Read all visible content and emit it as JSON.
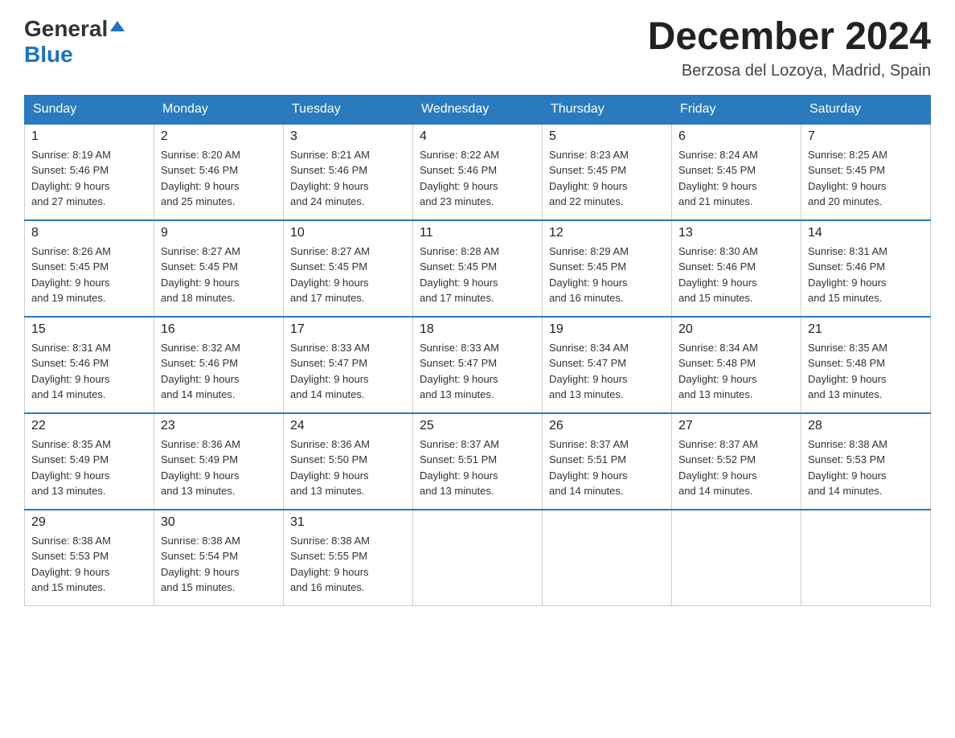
{
  "header": {
    "logo": {
      "general": "General",
      "blue": "Blue",
      "tagline": ""
    },
    "title": "December 2024",
    "subtitle": "Berzosa del Lozoya, Madrid, Spain"
  },
  "days_of_week": [
    "Sunday",
    "Monday",
    "Tuesday",
    "Wednesday",
    "Thursday",
    "Friday",
    "Saturday"
  ],
  "weeks": [
    [
      {
        "day": "1",
        "sunrise": "Sunrise: 8:19 AM",
        "sunset": "Sunset: 5:46 PM",
        "daylight": "Daylight: 9 hours and 27 minutes."
      },
      {
        "day": "2",
        "sunrise": "Sunrise: 8:20 AM",
        "sunset": "Sunset: 5:46 PM",
        "daylight": "Daylight: 9 hours and 25 minutes."
      },
      {
        "day": "3",
        "sunrise": "Sunrise: 8:21 AM",
        "sunset": "Sunset: 5:46 PM",
        "daylight": "Daylight: 9 hours and 24 minutes."
      },
      {
        "day": "4",
        "sunrise": "Sunrise: 8:22 AM",
        "sunset": "Sunset: 5:46 PM",
        "daylight": "Daylight: 9 hours and 23 minutes."
      },
      {
        "day": "5",
        "sunrise": "Sunrise: 8:23 AM",
        "sunset": "Sunset: 5:45 PM",
        "daylight": "Daylight: 9 hours and 22 minutes."
      },
      {
        "day": "6",
        "sunrise": "Sunrise: 8:24 AM",
        "sunset": "Sunset: 5:45 PM",
        "daylight": "Daylight: 9 hours and 21 minutes."
      },
      {
        "day": "7",
        "sunrise": "Sunrise: 8:25 AM",
        "sunset": "Sunset: 5:45 PM",
        "daylight": "Daylight: 9 hours and 20 minutes."
      }
    ],
    [
      {
        "day": "8",
        "sunrise": "Sunrise: 8:26 AM",
        "sunset": "Sunset: 5:45 PM",
        "daylight": "Daylight: 9 hours and 19 minutes."
      },
      {
        "day": "9",
        "sunrise": "Sunrise: 8:27 AM",
        "sunset": "Sunset: 5:45 PM",
        "daylight": "Daylight: 9 hours and 18 minutes."
      },
      {
        "day": "10",
        "sunrise": "Sunrise: 8:27 AM",
        "sunset": "Sunset: 5:45 PM",
        "daylight": "Daylight: 9 hours and 17 minutes."
      },
      {
        "day": "11",
        "sunrise": "Sunrise: 8:28 AM",
        "sunset": "Sunset: 5:45 PM",
        "daylight": "Daylight: 9 hours and 17 minutes."
      },
      {
        "day": "12",
        "sunrise": "Sunrise: 8:29 AM",
        "sunset": "Sunset: 5:45 PM",
        "daylight": "Daylight: 9 hours and 16 minutes."
      },
      {
        "day": "13",
        "sunrise": "Sunrise: 8:30 AM",
        "sunset": "Sunset: 5:46 PM",
        "daylight": "Daylight: 9 hours and 15 minutes."
      },
      {
        "day": "14",
        "sunrise": "Sunrise: 8:31 AM",
        "sunset": "Sunset: 5:46 PM",
        "daylight": "Daylight: 9 hours and 15 minutes."
      }
    ],
    [
      {
        "day": "15",
        "sunrise": "Sunrise: 8:31 AM",
        "sunset": "Sunset: 5:46 PM",
        "daylight": "Daylight: 9 hours and 14 minutes."
      },
      {
        "day": "16",
        "sunrise": "Sunrise: 8:32 AM",
        "sunset": "Sunset: 5:46 PM",
        "daylight": "Daylight: 9 hours and 14 minutes."
      },
      {
        "day": "17",
        "sunrise": "Sunrise: 8:33 AM",
        "sunset": "Sunset: 5:47 PM",
        "daylight": "Daylight: 9 hours and 14 minutes."
      },
      {
        "day": "18",
        "sunrise": "Sunrise: 8:33 AM",
        "sunset": "Sunset: 5:47 PM",
        "daylight": "Daylight: 9 hours and 13 minutes."
      },
      {
        "day": "19",
        "sunrise": "Sunrise: 8:34 AM",
        "sunset": "Sunset: 5:47 PM",
        "daylight": "Daylight: 9 hours and 13 minutes."
      },
      {
        "day": "20",
        "sunrise": "Sunrise: 8:34 AM",
        "sunset": "Sunset: 5:48 PM",
        "daylight": "Daylight: 9 hours and 13 minutes."
      },
      {
        "day": "21",
        "sunrise": "Sunrise: 8:35 AM",
        "sunset": "Sunset: 5:48 PM",
        "daylight": "Daylight: 9 hours and 13 minutes."
      }
    ],
    [
      {
        "day": "22",
        "sunrise": "Sunrise: 8:35 AM",
        "sunset": "Sunset: 5:49 PM",
        "daylight": "Daylight: 9 hours and 13 minutes."
      },
      {
        "day": "23",
        "sunrise": "Sunrise: 8:36 AM",
        "sunset": "Sunset: 5:49 PM",
        "daylight": "Daylight: 9 hours and 13 minutes."
      },
      {
        "day": "24",
        "sunrise": "Sunrise: 8:36 AM",
        "sunset": "Sunset: 5:50 PM",
        "daylight": "Daylight: 9 hours and 13 minutes."
      },
      {
        "day": "25",
        "sunrise": "Sunrise: 8:37 AM",
        "sunset": "Sunset: 5:51 PM",
        "daylight": "Daylight: 9 hours and 13 minutes."
      },
      {
        "day": "26",
        "sunrise": "Sunrise: 8:37 AM",
        "sunset": "Sunset: 5:51 PM",
        "daylight": "Daylight: 9 hours and 14 minutes."
      },
      {
        "day": "27",
        "sunrise": "Sunrise: 8:37 AM",
        "sunset": "Sunset: 5:52 PM",
        "daylight": "Daylight: 9 hours and 14 minutes."
      },
      {
        "day": "28",
        "sunrise": "Sunrise: 8:38 AM",
        "sunset": "Sunset: 5:53 PM",
        "daylight": "Daylight: 9 hours and 14 minutes."
      }
    ],
    [
      {
        "day": "29",
        "sunrise": "Sunrise: 8:38 AM",
        "sunset": "Sunset: 5:53 PM",
        "daylight": "Daylight: 9 hours and 15 minutes."
      },
      {
        "day": "30",
        "sunrise": "Sunrise: 8:38 AM",
        "sunset": "Sunset: 5:54 PM",
        "daylight": "Daylight: 9 hours and 15 minutes."
      },
      {
        "day": "31",
        "sunrise": "Sunrise: 8:38 AM",
        "sunset": "Sunset: 5:55 PM",
        "daylight": "Daylight: 9 hours and 16 minutes."
      },
      null,
      null,
      null,
      null
    ]
  ]
}
